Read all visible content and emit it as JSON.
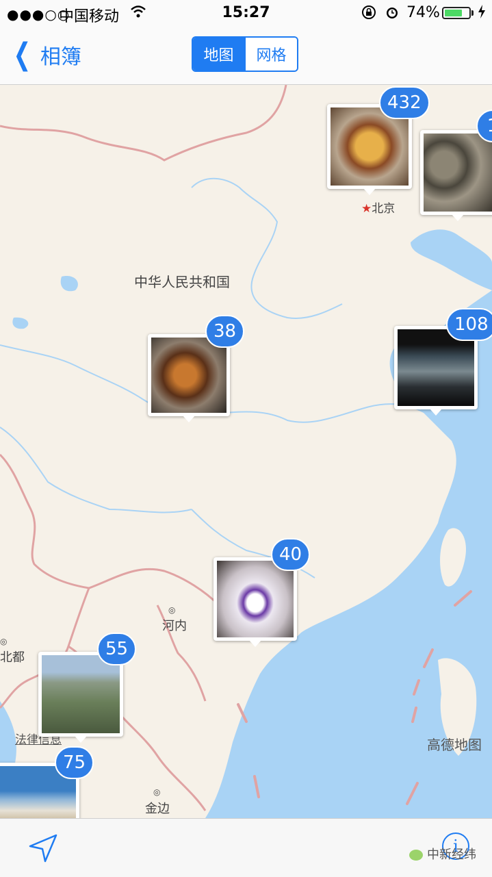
{
  "status_bar": {
    "signal": "●●●○○",
    "carrier": "中国移动",
    "wifi_icon": "wifi-icon",
    "time": "15:27",
    "battery_percent": "74%",
    "battery_level": 0.74
  },
  "nav": {
    "back_label": "相簿",
    "segments": [
      "地图",
      "网格"
    ],
    "selected_segment": "地图"
  },
  "map": {
    "country_label": "中华人民共和国",
    "capital_label": "北京",
    "city_labels": [
      "河内",
      "金边",
      "北都"
    ],
    "legal_link": "法律信息",
    "provider": "高德地图"
  },
  "clusters": [
    {
      "count": "432",
      "subject": "grilled-meat-platter"
    },
    {
      "count": "1",
      "subject": "clams"
    },
    {
      "count": "38",
      "subject": "hotpot-skewers"
    },
    {
      "count": "108",
      "subject": "dark-exhibition-screen"
    },
    {
      "count": "40",
      "subject": "purple-bead-bracelet"
    },
    {
      "count": "55",
      "subject": "aerial-view-from-plane"
    },
    {
      "count": "75",
      "subject": "beach-sky"
    }
  ],
  "toolbar": {
    "location_icon": "location-arrow-icon",
    "info_icon": "info-icon",
    "watermark": "中新经纬"
  },
  "colors": {
    "accent": "#1f7cf2",
    "badge": "#2f7ee6",
    "land": "#f6f1e8",
    "water": "#a9d3f5",
    "border": "#e0a3a3"
  }
}
